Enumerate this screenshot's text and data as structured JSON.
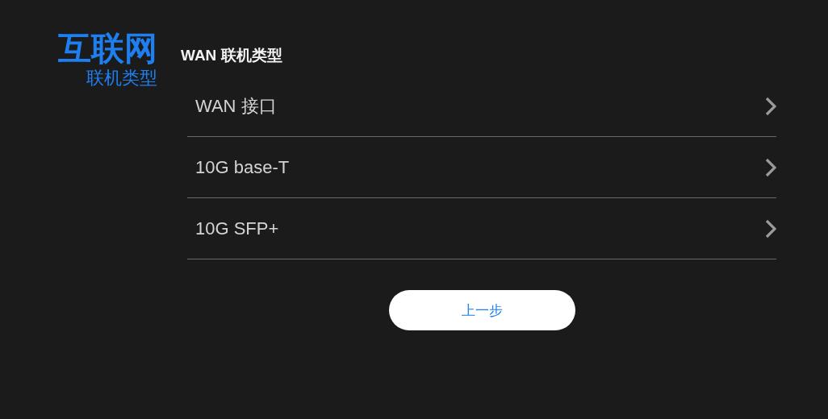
{
  "header": {
    "title": "互联网",
    "subtitle": "联机类型"
  },
  "section_title": "WAN 联机类型",
  "options": [
    {
      "label": "WAN 接口"
    },
    {
      "label": "10G base-T"
    },
    {
      "label": "10G SFP+"
    }
  ],
  "back_button": "上一步"
}
